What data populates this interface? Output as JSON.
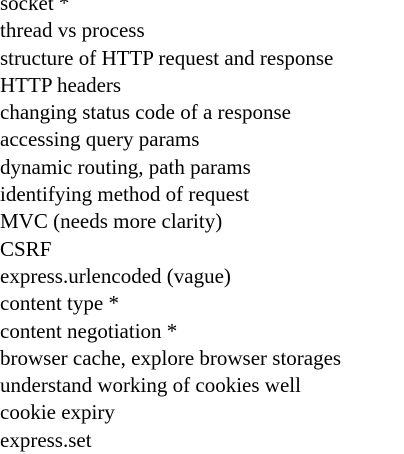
{
  "notes": [
    "socket *",
    "thread vs process",
    "structure of HTTP request and response",
    "HTTP headers",
    "changing status code of a response",
    "accessing query params",
    "dynamic routing, path params",
    "identifying method of request",
    "MVC (needs more clarity)",
    "CSRF",
    "express.urlencoded (vague)",
    "content type *",
    "content negotiation *",
    "browser cache, explore browser storages",
    "understand working of cookies well",
    "cookie expiry",
    "express.set"
  ]
}
